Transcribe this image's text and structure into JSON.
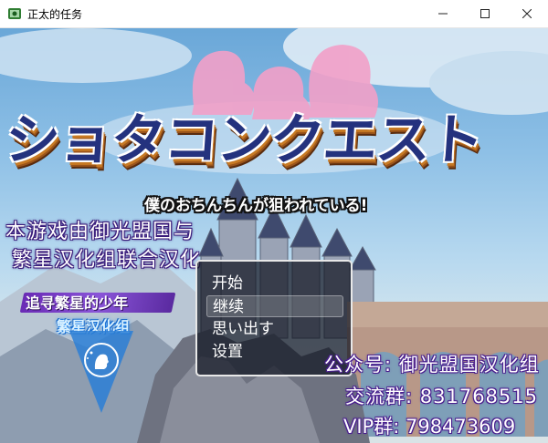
{
  "window": {
    "title": "正太的任务",
    "icon": "rpg-app-icon",
    "controls": [
      "minimize-icon",
      "maximize-icon",
      "close-icon"
    ]
  },
  "game": {
    "logo_title": "ショタコンクエスト",
    "logo_subtitle": "僕のおちんちんが狙われている!",
    "credit_line1": "本游戏由御光盟国与",
    "credit_line2": "繁星汉化组联合汉化",
    "group_badge_line1": "追寻繁星的少年",
    "group_badge_line2": "繁星汉化组",
    "menu": {
      "items": [
        "开始",
        "继续",
        "思い出す",
        "设置"
      ],
      "selected_index": 1
    },
    "info_lines": [
      "公众号: 御光盟国汉化组",
      "交流群: 831768515",
      "VIP群: 798473609"
    ],
    "colors": {
      "logo_blue": "#24327e",
      "logo_orange": "#c77a24",
      "credit_purple": "#3a1b7a",
      "menu_bg": "#12162299"
    }
  }
}
